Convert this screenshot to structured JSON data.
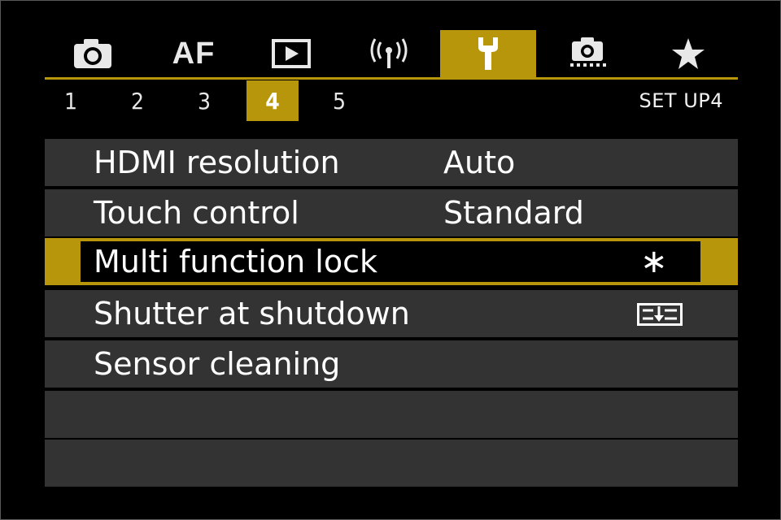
{
  "tabs": [
    {
      "id": "shooting",
      "icon": "camera-icon",
      "active": false
    },
    {
      "id": "af",
      "text": "AF",
      "active": false
    },
    {
      "id": "playback",
      "icon": "playback-icon",
      "active": false
    },
    {
      "id": "wireless",
      "icon": "wireless-icon",
      "active": false
    },
    {
      "id": "setup",
      "icon": "wrench-icon",
      "active": true
    },
    {
      "id": "custom",
      "icon": "custom-functions-icon",
      "active": false
    },
    {
      "id": "mymenu",
      "icon": "star-icon",
      "active": false
    }
  ],
  "pages": [
    "1",
    "2",
    "3",
    "4",
    "5"
  ],
  "active_page": "4",
  "section_label": "SET UP4",
  "menu": {
    "items": [
      {
        "label": "HDMI resolution",
        "value": "Auto"
      },
      {
        "label": "Touch control",
        "value": "Standard"
      },
      {
        "label": "Multi function lock",
        "value": "∗"
      },
      {
        "label": "Shutter at shutdown",
        "value_icon": "shutter-retract-icon"
      },
      {
        "label": "Sensor cleaning",
        "value": ""
      },
      {
        "label": "",
        "value": ""
      },
      {
        "label": "",
        "value": ""
      }
    ],
    "selected_index": 2
  },
  "colors": {
    "accent": "#b8960c",
    "row_background": "#333333",
    "background": "#000000",
    "text": "#ffffff"
  }
}
